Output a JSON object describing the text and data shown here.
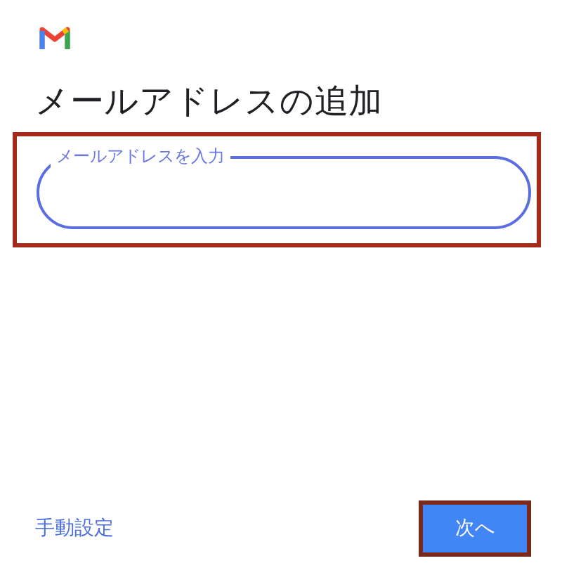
{
  "title": "メールアドレスの追加",
  "email_field": {
    "label": "メールアドレスを入力",
    "highlighted": true
  },
  "footer": {
    "manual_link": "手動設定",
    "next_button": {
      "label": "次へ",
      "highlighted": true
    }
  }
}
